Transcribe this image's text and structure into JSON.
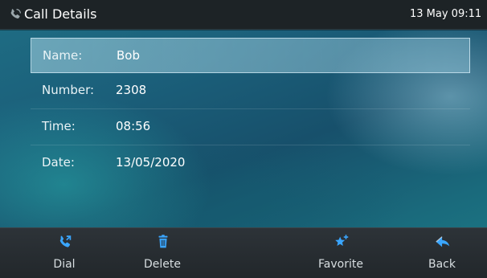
{
  "header": {
    "title": "Call Details",
    "clock": "13 May 09:11",
    "icon": "phone-icon"
  },
  "details": [
    {
      "label": "Name:",
      "value": "Bob",
      "selected": true
    },
    {
      "label": "Number:",
      "value": "2308",
      "selected": false
    },
    {
      "label": "Time:",
      "value": "08:56",
      "selected": false
    },
    {
      "label": "Date:",
      "value": "13/05/2020",
      "selected": false
    }
  ],
  "softkeys": [
    {
      "label": "Dial",
      "icon": "dial-icon"
    },
    {
      "label": "Delete",
      "icon": "trash-icon"
    },
    {
      "label": "",
      "icon": ""
    },
    {
      "label": "Favorite",
      "icon": "star-plus-icon"
    },
    {
      "label": "Back",
      "icon": "back-arrow-icon"
    }
  ],
  "colors": {
    "accent_icon": "#3aa6ff",
    "topbar_bg": "#1d2326",
    "softbar_bg": "#262c30"
  }
}
